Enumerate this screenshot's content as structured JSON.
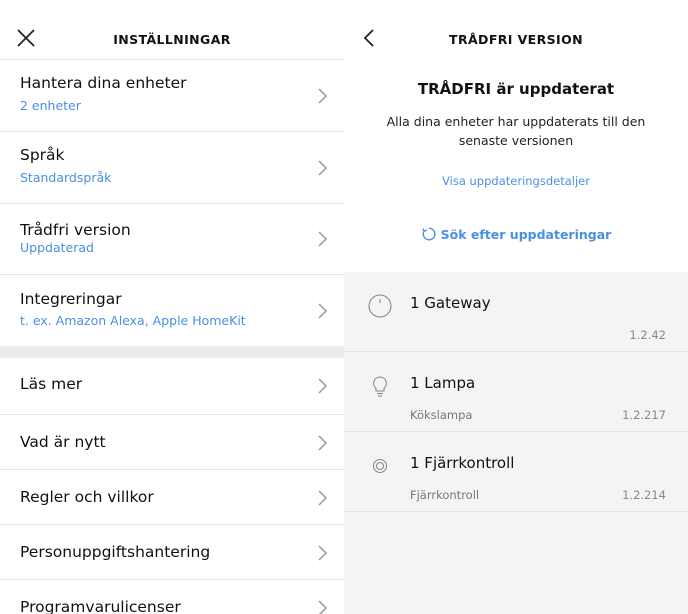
{
  "left": {
    "title": "INSTÄLLNINGAR",
    "rows": [
      {
        "label": "Hantera dina enheter",
        "sub": "2 enheter"
      },
      {
        "label": "Språk",
        "sub": "Standardspråk"
      },
      {
        "label": "Trådfri version",
        "sub": "Uppdaterad"
      },
      {
        "label": "Integreringar",
        "sub": "t. ex. Amazon Alexa, Apple HomeKit"
      }
    ],
    "rows2": [
      {
        "label": "Läs mer"
      },
      {
        "label": "Vad är nytt"
      },
      {
        "label": "Regler och villkor"
      },
      {
        "label": "Personuppgiftshantering"
      },
      {
        "label": "Programvarulicenser"
      }
    ]
  },
  "right": {
    "title": "TRÅDFRI VERSION",
    "heading": "TRÅDFRI är uppdaterat",
    "description": "Alla dina enheter har uppdaterats till den senaste versionen",
    "details_link": "Visa uppdateringsdetaljer",
    "search_label": "Sök efter uppdateringar",
    "devices": [
      {
        "name": "1 Gateway",
        "sub": "",
        "version": "1.2.42",
        "icon": "gateway-icon"
      },
      {
        "name": "1 Lampa",
        "sub": "Kökslampa",
        "version": "1.2.217",
        "icon": "bulb-icon"
      },
      {
        "name": "1 Fjärrkontroll",
        "sub": "Fjärrkontroll",
        "version": "1.2.214",
        "icon": "remote-icon"
      }
    ]
  }
}
